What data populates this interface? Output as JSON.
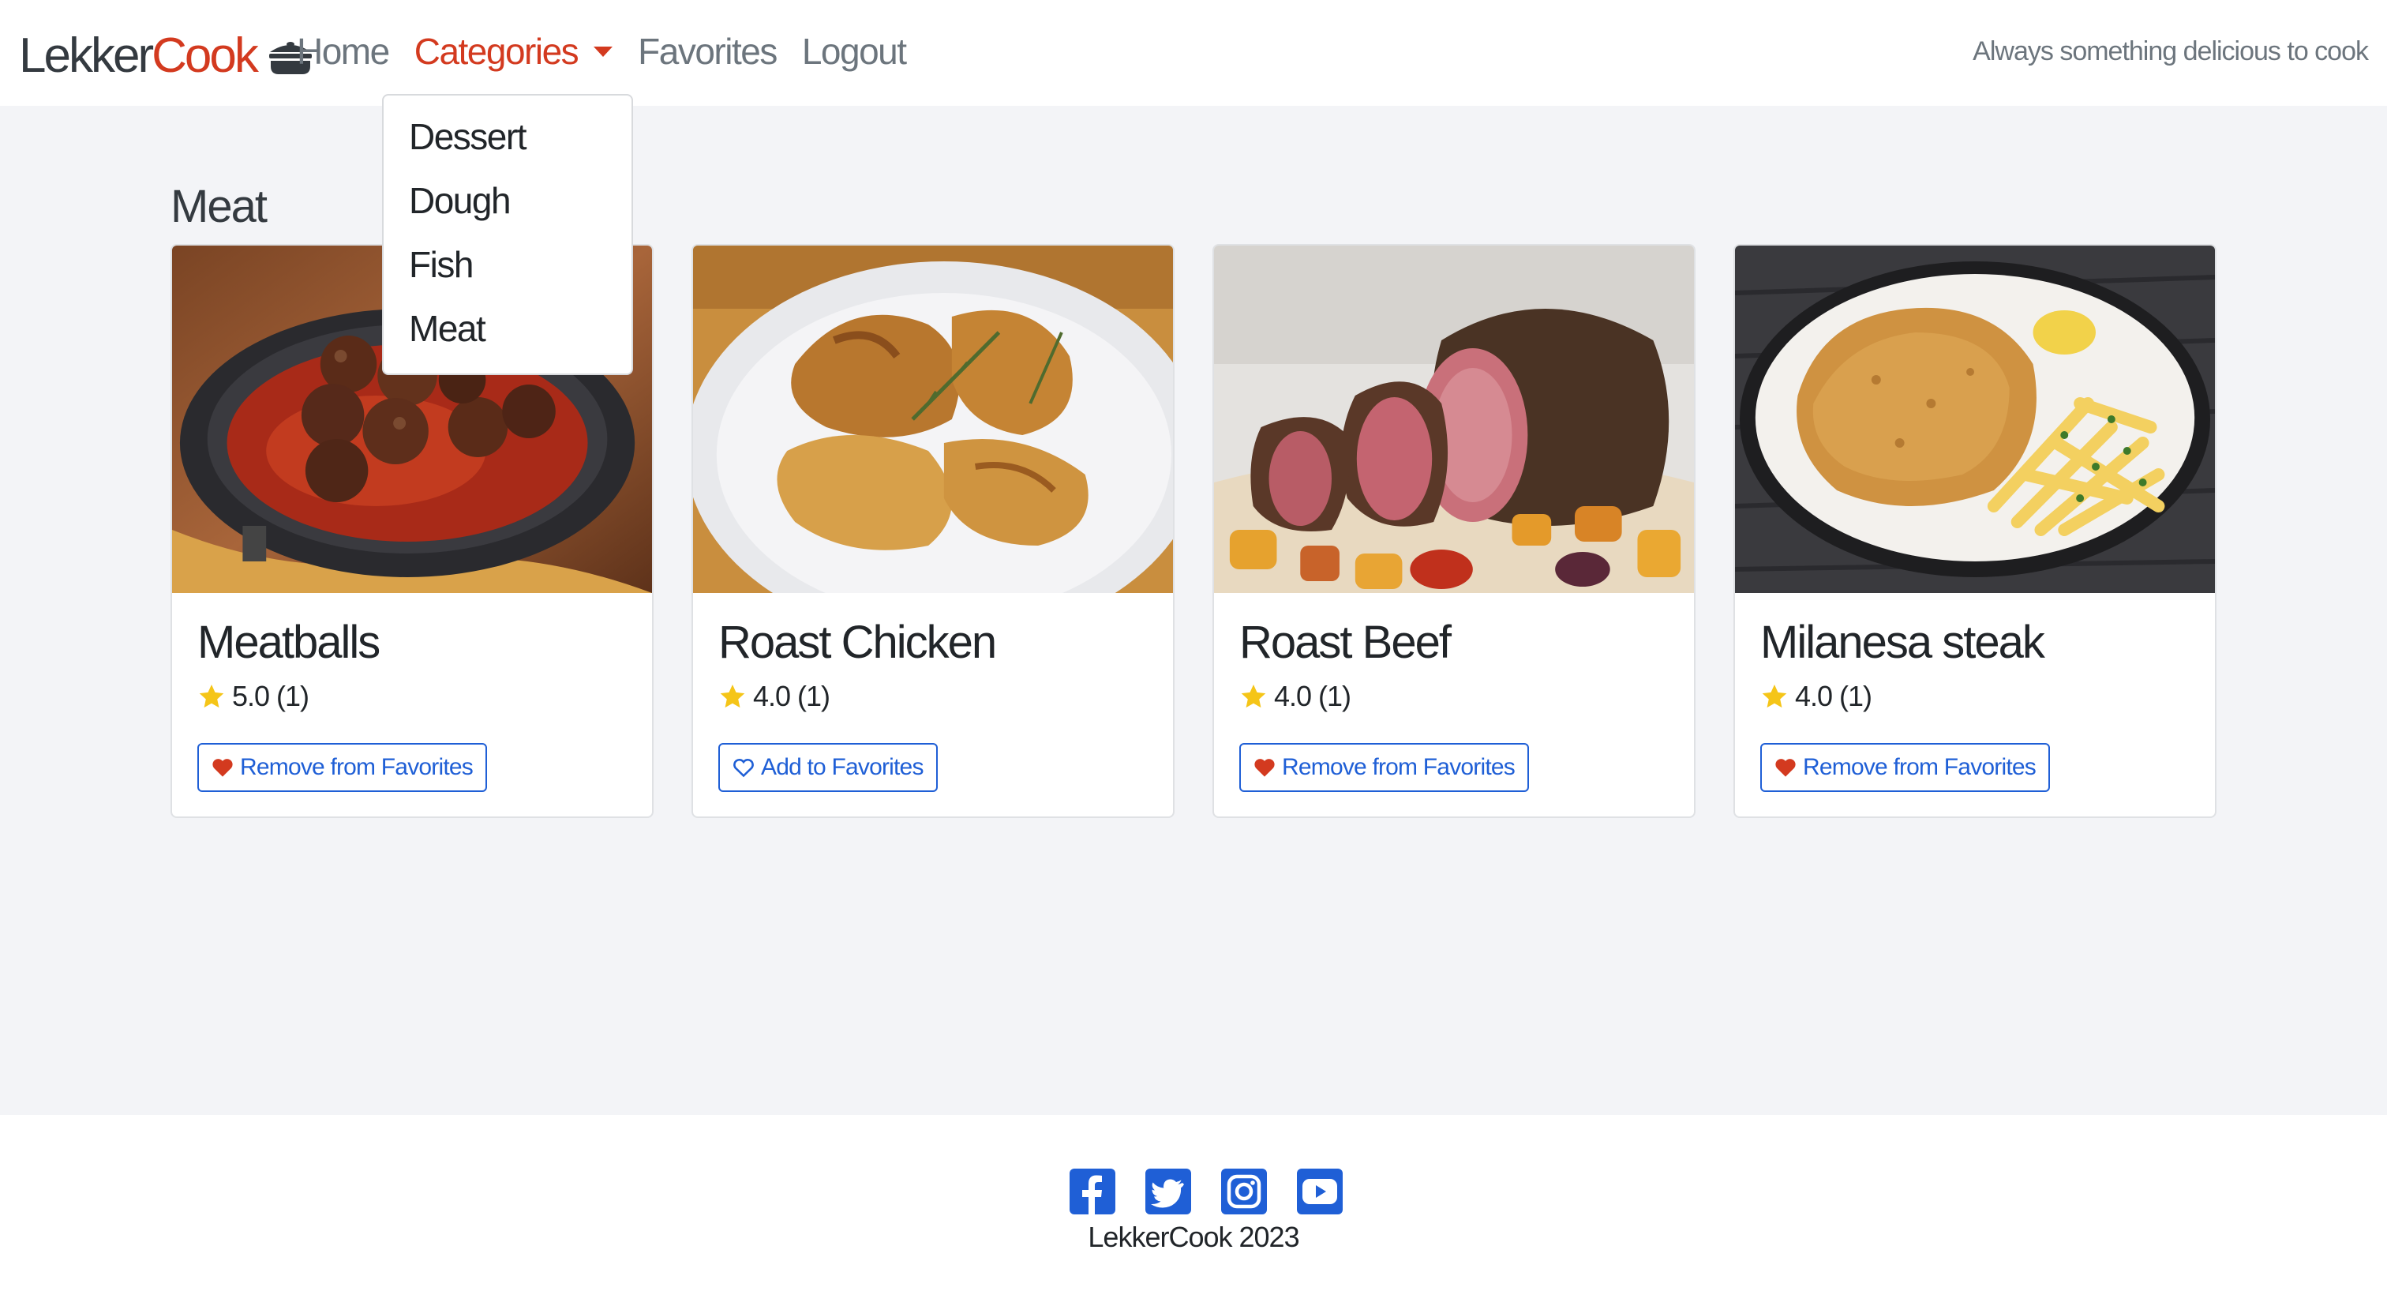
{
  "brand": {
    "part1": "Lekker",
    "part2": "Cook",
    "icon": "pot-icon"
  },
  "nav": {
    "home": "Home",
    "categories": "Categories",
    "favorites": "Favorites",
    "logout": "Logout"
  },
  "tagline": "Always something delicious to cook",
  "dropdown": {
    "items": [
      "Dessert",
      "Dough",
      "Fish",
      "Meat"
    ]
  },
  "section": {
    "title": "Meat"
  },
  "recipes": [
    {
      "name": "Meatballs",
      "rating": "5.0 (1)",
      "button": "Remove from Favorites",
      "favorite": true
    },
    {
      "name": "Roast Chicken",
      "rating": "4.0 (1)",
      "button": "Add to Favorites",
      "favorite": false
    },
    {
      "name": "Roast Beef",
      "rating": "4.0 (1)",
      "button": "Remove from Favorites",
      "favorite": true
    },
    {
      "name": "Milanesa steak",
      "rating": "4.0 (1)",
      "button": "Remove from Favorites",
      "favorite": true
    }
  ],
  "footer": {
    "socials": [
      "facebook-icon",
      "twitter-icon",
      "instagram-icon",
      "youtube-icon"
    ],
    "copyright": "LekkerCook 2023"
  },
  "colors": {
    "accent": "#d33a1f",
    "link": "#1f5fd6",
    "star": "#f5c518",
    "background": "#f3f4f7"
  }
}
